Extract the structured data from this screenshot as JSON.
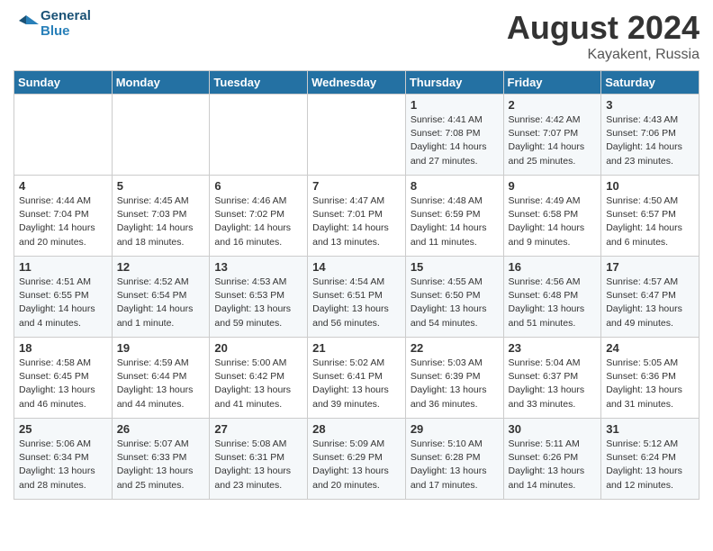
{
  "header": {
    "logo_line1": "General",
    "logo_line2": "Blue",
    "month_year": "August 2024",
    "location": "Kayakent, Russia"
  },
  "days_of_week": [
    "Sunday",
    "Monday",
    "Tuesday",
    "Wednesday",
    "Thursday",
    "Friday",
    "Saturday"
  ],
  "weeks": [
    [
      {
        "num": "",
        "info": ""
      },
      {
        "num": "",
        "info": ""
      },
      {
        "num": "",
        "info": ""
      },
      {
        "num": "",
        "info": ""
      },
      {
        "num": "1",
        "info": "Sunrise: 4:41 AM\nSunset: 7:08 PM\nDaylight: 14 hours\nand 27 minutes."
      },
      {
        "num": "2",
        "info": "Sunrise: 4:42 AM\nSunset: 7:07 PM\nDaylight: 14 hours\nand 25 minutes."
      },
      {
        "num": "3",
        "info": "Sunrise: 4:43 AM\nSunset: 7:06 PM\nDaylight: 14 hours\nand 23 minutes."
      }
    ],
    [
      {
        "num": "4",
        "info": "Sunrise: 4:44 AM\nSunset: 7:04 PM\nDaylight: 14 hours\nand 20 minutes."
      },
      {
        "num": "5",
        "info": "Sunrise: 4:45 AM\nSunset: 7:03 PM\nDaylight: 14 hours\nand 18 minutes."
      },
      {
        "num": "6",
        "info": "Sunrise: 4:46 AM\nSunset: 7:02 PM\nDaylight: 14 hours\nand 16 minutes."
      },
      {
        "num": "7",
        "info": "Sunrise: 4:47 AM\nSunset: 7:01 PM\nDaylight: 14 hours\nand 13 minutes."
      },
      {
        "num": "8",
        "info": "Sunrise: 4:48 AM\nSunset: 6:59 PM\nDaylight: 14 hours\nand 11 minutes."
      },
      {
        "num": "9",
        "info": "Sunrise: 4:49 AM\nSunset: 6:58 PM\nDaylight: 14 hours\nand 9 minutes."
      },
      {
        "num": "10",
        "info": "Sunrise: 4:50 AM\nSunset: 6:57 PM\nDaylight: 14 hours\nand 6 minutes."
      }
    ],
    [
      {
        "num": "11",
        "info": "Sunrise: 4:51 AM\nSunset: 6:55 PM\nDaylight: 14 hours\nand 4 minutes."
      },
      {
        "num": "12",
        "info": "Sunrise: 4:52 AM\nSunset: 6:54 PM\nDaylight: 14 hours\nand 1 minute."
      },
      {
        "num": "13",
        "info": "Sunrise: 4:53 AM\nSunset: 6:53 PM\nDaylight: 13 hours\nand 59 minutes."
      },
      {
        "num": "14",
        "info": "Sunrise: 4:54 AM\nSunset: 6:51 PM\nDaylight: 13 hours\nand 56 minutes."
      },
      {
        "num": "15",
        "info": "Sunrise: 4:55 AM\nSunset: 6:50 PM\nDaylight: 13 hours\nand 54 minutes."
      },
      {
        "num": "16",
        "info": "Sunrise: 4:56 AM\nSunset: 6:48 PM\nDaylight: 13 hours\nand 51 minutes."
      },
      {
        "num": "17",
        "info": "Sunrise: 4:57 AM\nSunset: 6:47 PM\nDaylight: 13 hours\nand 49 minutes."
      }
    ],
    [
      {
        "num": "18",
        "info": "Sunrise: 4:58 AM\nSunset: 6:45 PM\nDaylight: 13 hours\nand 46 minutes."
      },
      {
        "num": "19",
        "info": "Sunrise: 4:59 AM\nSunset: 6:44 PM\nDaylight: 13 hours\nand 44 minutes."
      },
      {
        "num": "20",
        "info": "Sunrise: 5:00 AM\nSunset: 6:42 PM\nDaylight: 13 hours\nand 41 minutes."
      },
      {
        "num": "21",
        "info": "Sunrise: 5:02 AM\nSunset: 6:41 PM\nDaylight: 13 hours\nand 39 minutes."
      },
      {
        "num": "22",
        "info": "Sunrise: 5:03 AM\nSunset: 6:39 PM\nDaylight: 13 hours\nand 36 minutes."
      },
      {
        "num": "23",
        "info": "Sunrise: 5:04 AM\nSunset: 6:37 PM\nDaylight: 13 hours\nand 33 minutes."
      },
      {
        "num": "24",
        "info": "Sunrise: 5:05 AM\nSunset: 6:36 PM\nDaylight: 13 hours\nand 31 minutes."
      }
    ],
    [
      {
        "num": "25",
        "info": "Sunrise: 5:06 AM\nSunset: 6:34 PM\nDaylight: 13 hours\nand 28 minutes."
      },
      {
        "num": "26",
        "info": "Sunrise: 5:07 AM\nSunset: 6:33 PM\nDaylight: 13 hours\nand 25 minutes."
      },
      {
        "num": "27",
        "info": "Sunrise: 5:08 AM\nSunset: 6:31 PM\nDaylight: 13 hours\nand 23 minutes."
      },
      {
        "num": "28",
        "info": "Sunrise: 5:09 AM\nSunset: 6:29 PM\nDaylight: 13 hours\nand 20 minutes."
      },
      {
        "num": "29",
        "info": "Sunrise: 5:10 AM\nSunset: 6:28 PM\nDaylight: 13 hours\nand 17 minutes."
      },
      {
        "num": "30",
        "info": "Sunrise: 5:11 AM\nSunset: 6:26 PM\nDaylight: 13 hours\nand 14 minutes."
      },
      {
        "num": "31",
        "info": "Sunrise: 5:12 AM\nSunset: 6:24 PM\nDaylight: 13 hours\nand 12 minutes."
      }
    ]
  ]
}
